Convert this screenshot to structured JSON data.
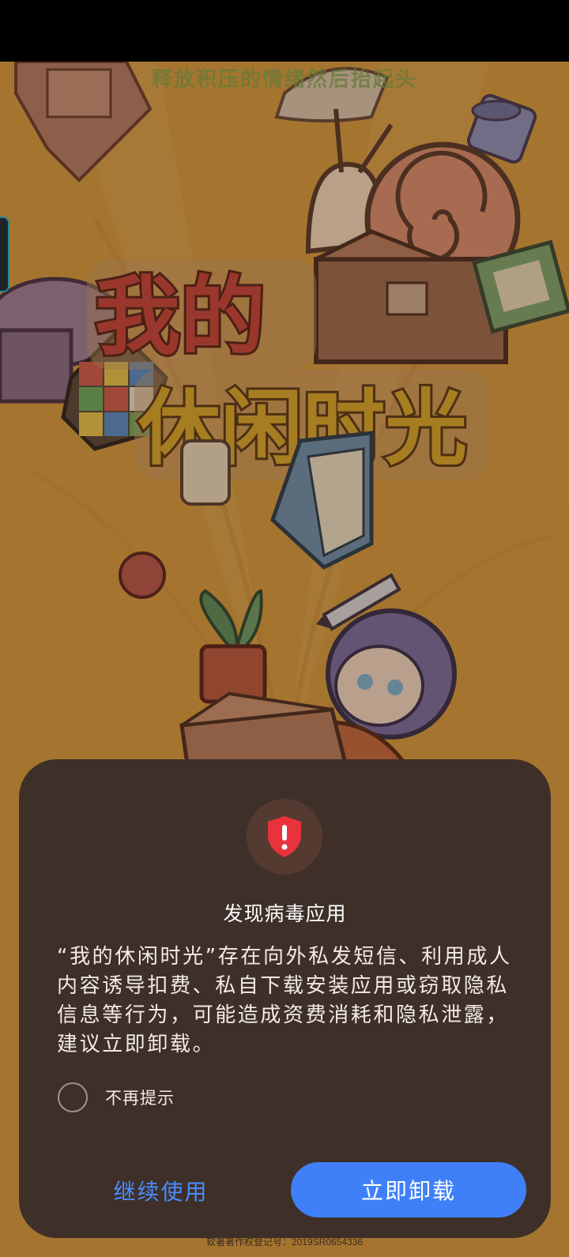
{
  "splash": {
    "tagline": "释放积压的情绪然后抬起头",
    "app_name_line1": "我的",
    "app_name_line2": "休闲时光",
    "copyright": "软著著作权登记号：2019SR0654336"
  },
  "dialog": {
    "icon": "shield-alert-icon",
    "title": "发现病毒应用",
    "message": "“我的休闲时光”存在向外私发短信、利用成人内容诱导扣费、私自下载安装应用或窃取隐私信息等行为，可能造成资费消耗和隐私泄露，建议立即卸载。",
    "checkbox_label": "不再提示",
    "checkbox_checked": false,
    "continue_label": "继续使用",
    "uninstall_label": "立即卸载"
  },
  "colors": {
    "splash_bg": "#d69a3e",
    "dialog_bg": "#3e3029",
    "accent": "#3f80f8",
    "danger": "#e8323c"
  }
}
